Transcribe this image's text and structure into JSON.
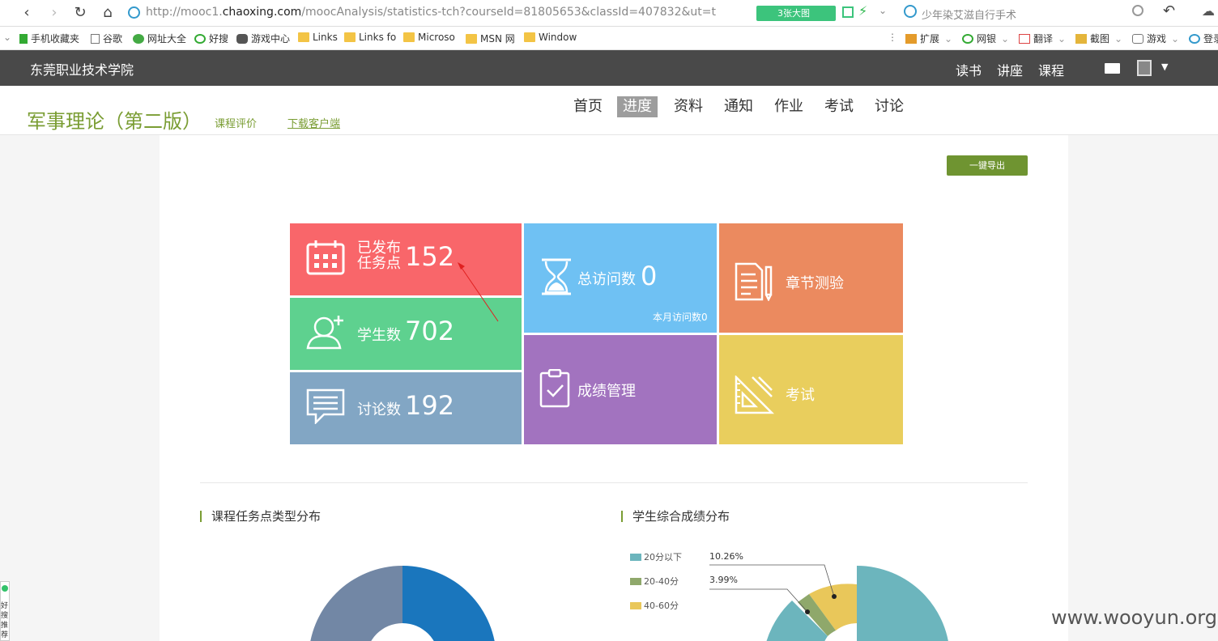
{
  "browser": {
    "url_prefix": "http://mooc1.",
    "url_domain": "chaoxing.com",
    "url_path": "/moocAnalysis/statistics-tch?courseId=81805653&classId=407832&ut=t",
    "screen_badge": "3张大图",
    "search_placeholder": "少年染艾滋自行手术"
  },
  "bookmarks": {
    "items": [
      "手机收藏夹",
      "谷歌",
      "网址大全",
      "好搜",
      "游戏中心",
      "Links",
      "Links fo",
      "Microso",
      "MSN 网",
      "Window"
    ],
    "right": [
      "扩展",
      "网银",
      "翻译",
      "截图",
      "游戏",
      "登录"
    ]
  },
  "site": {
    "school": "东莞职业技术学院",
    "nav": [
      "读书",
      "讲座",
      "课程"
    ]
  },
  "course": {
    "title": "军事理论（第二版）",
    "eval_link": "课程评价",
    "download_link": "下载客户端",
    "tabs": [
      "首页",
      "进度",
      "资料",
      "通知",
      "作业",
      "考试",
      "讨论"
    ],
    "active_tab": "进度"
  },
  "export_button": "一键导出",
  "tiles": {
    "published_label_1": "已发布",
    "published_label_2": "任务点",
    "published_value": "152",
    "students_label": "学生数",
    "students_value": "702",
    "discussion_label": "讨论数",
    "discussion_value": "192",
    "visits_label": "总访问数",
    "visits_value": "0",
    "monthly_visits": "本月访问数0",
    "chapter_quiz": "章节测验",
    "grades": "成绩管理",
    "exam": "考试"
  },
  "colors": {
    "published": "#f9666a",
    "students": "#5ed18f",
    "discussion": "#82a6c4",
    "visits": "#6fc1f3",
    "grades": "#a273bf",
    "quiz": "#eb8a5f",
    "exam": "#e9ce5d",
    "accent": "#7a9d33"
  },
  "sections": {
    "task_distribution": "课程任务点类型分布",
    "grade_distribution": "学生综合成绩分布"
  },
  "grade_legend": [
    {
      "label": "20分以下",
      "color": "#6cb5bd"
    },
    {
      "label": "20-40分",
      "color": "#8fa86b"
    },
    {
      "label": "40-60分",
      "color": "#e9c75a"
    }
  ],
  "grade_labels": [
    "10.26%",
    "3.99%"
  ],
  "watermark": "www.wooyun.org",
  "side_widget": "好搜推荐"
}
